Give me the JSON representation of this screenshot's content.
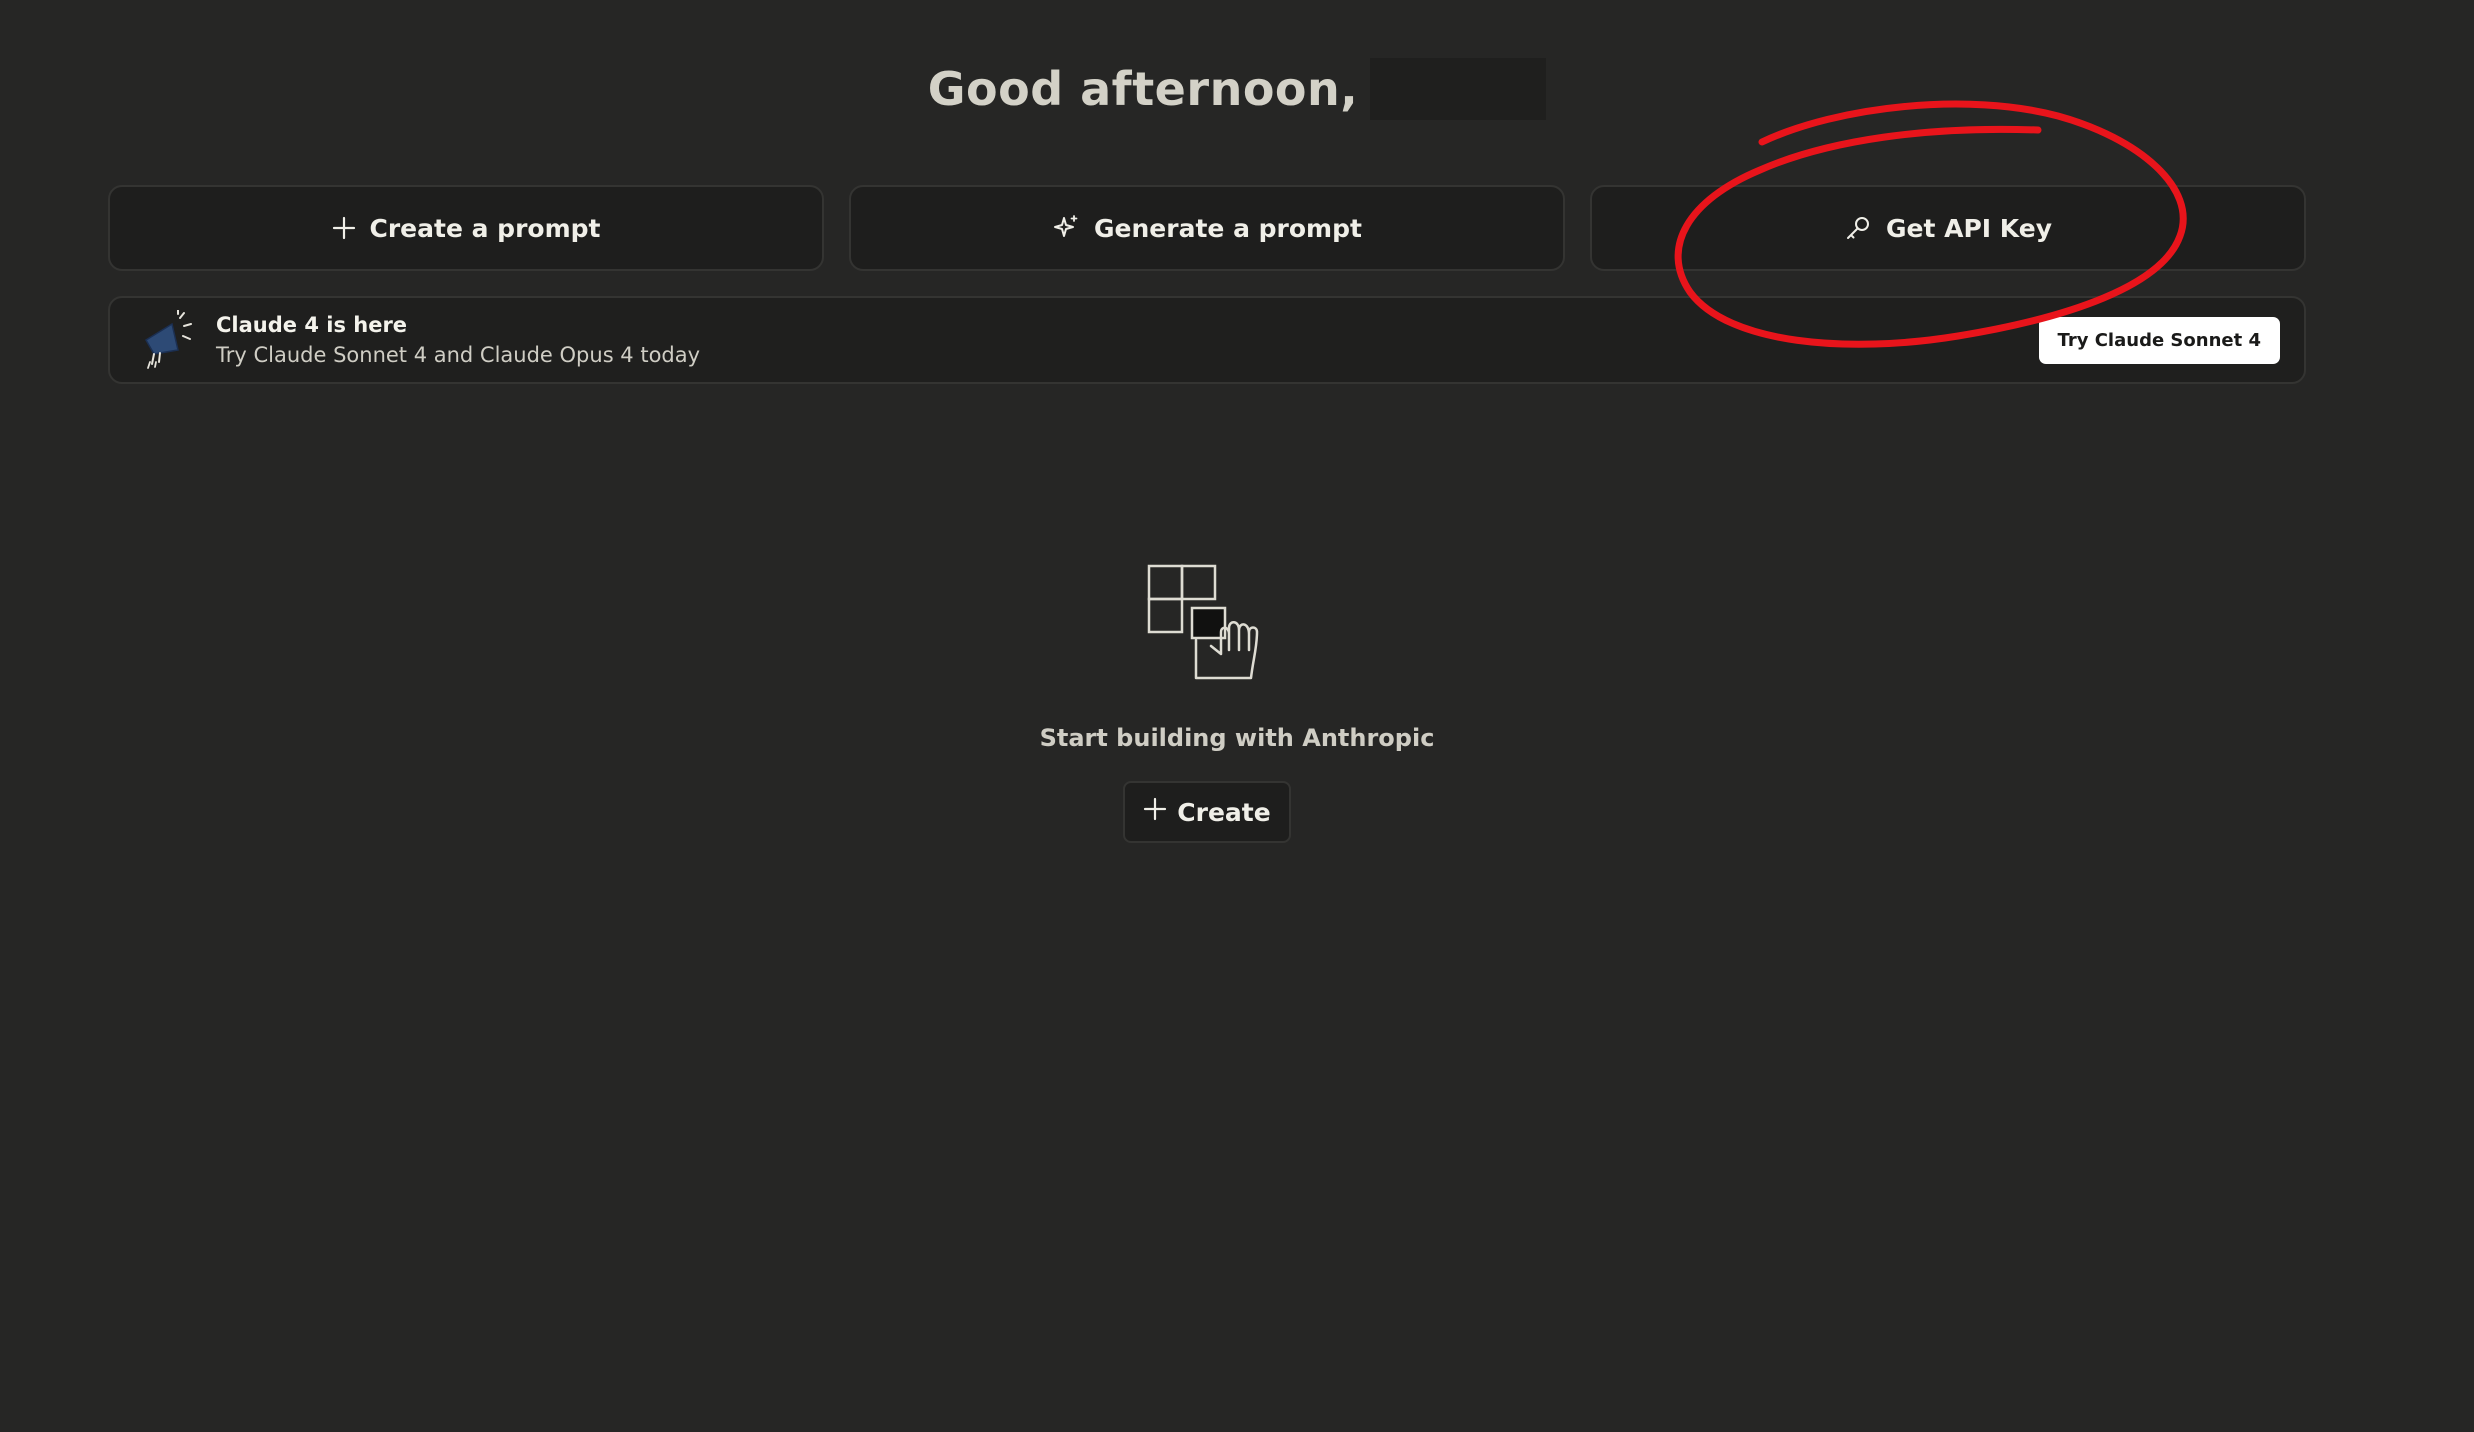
{
  "greeting": {
    "text": "Good afternoon,"
  },
  "actions": {
    "create_prompt_label": "Create a prompt",
    "generate_prompt_label": "Generate a prompt",
    "get_api_key_label": "Get API Key"
  },
  "banner": {
    "title": "Claude 4 is here",
    "subtitle": "Try Claude Sonnet 4 and Claude Opus 4 today",
    "button_label": "Try Claude Sonnet 4"
  },
  "empty_state": {
    "title": "Start building with Anthropic",
    "create_label": "Create"
  },
  "colors": {
    "background": "#262625",
    "annotation": "#e8141b",
    "banner_button": "#ffffff"
  },
  "icons": {
    "create_prompt": "plus-icon",
    "generate_prompt": "sparkle-icon",
    "get_api_key": "key-icon",
    "banner": "megaphone-icon",
    "empty_state": "grid-hand-illustration"
  }
}
